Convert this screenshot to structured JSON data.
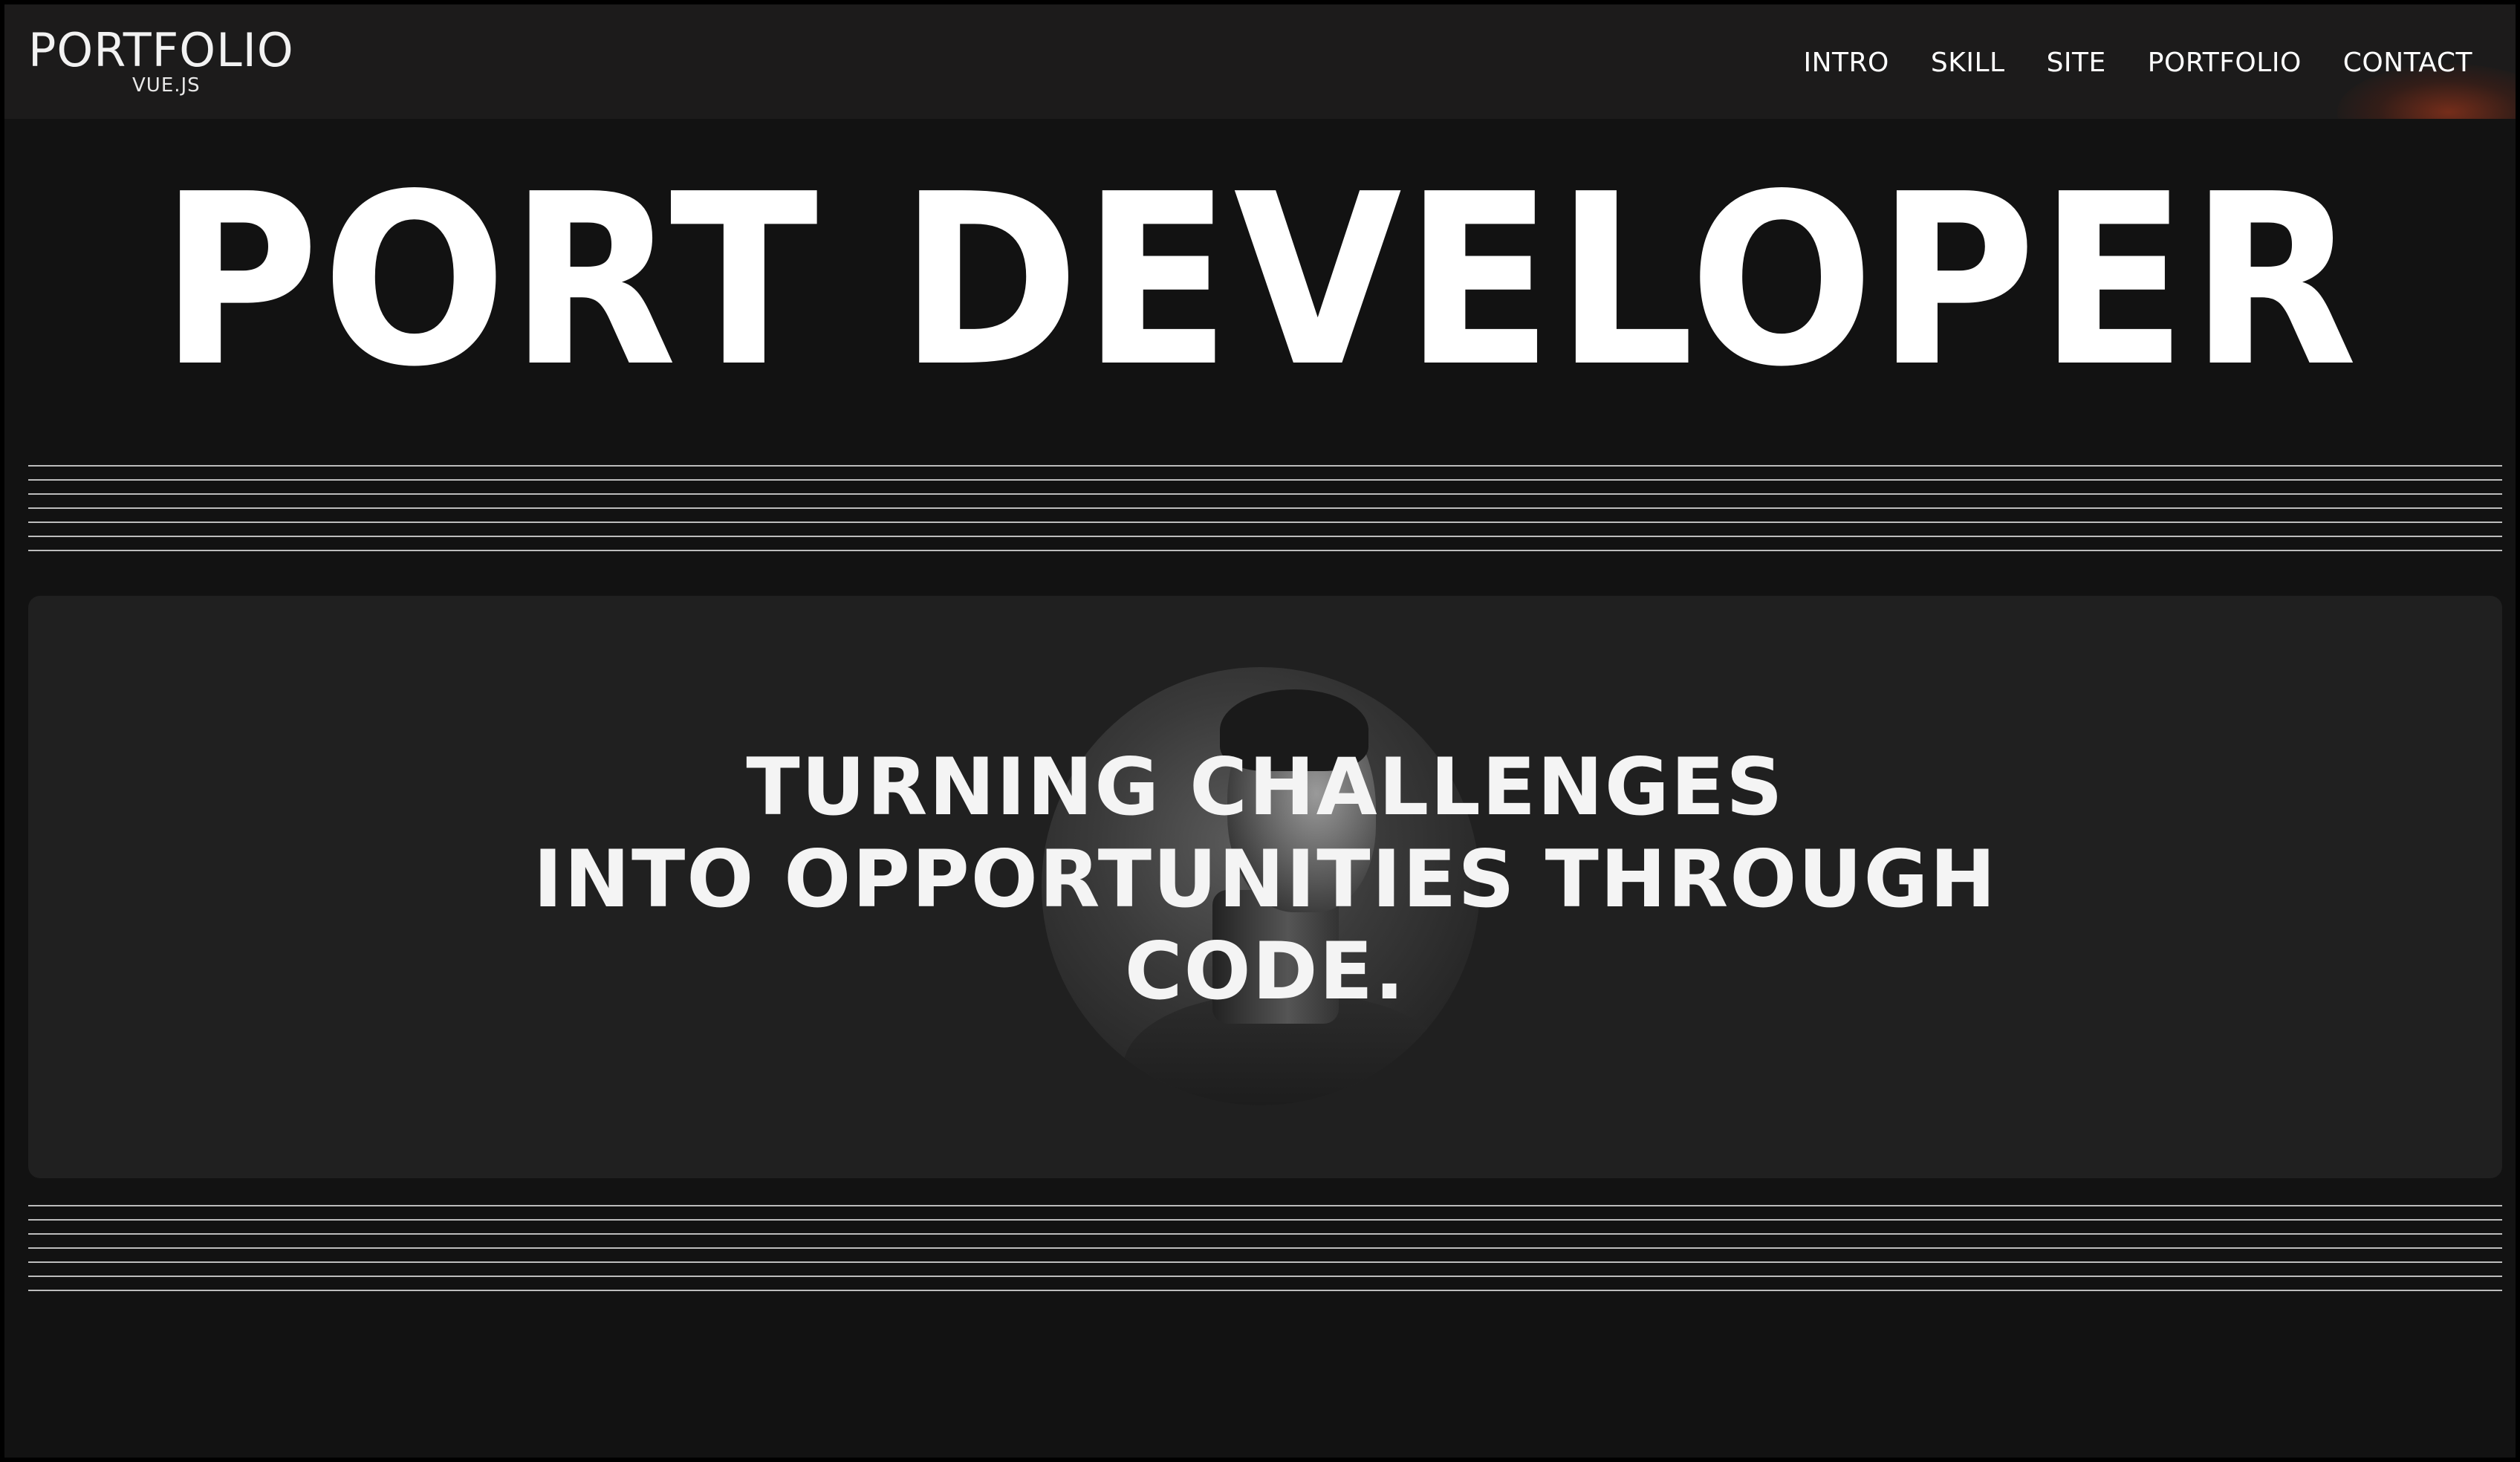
{
  "header": {
    "logo_title": "PORTFOLIO",
    "logo_subtitle": "VUE.JS",
    "nav": [
      {
        "label": "INTRO"
      },
      {
        "label": "SKILL"
      },
      {
        "label": "SITE"
      },
      {
        "label": "PORTFOLIO"
      },
      {
        "label": "CONTACT"
      }
    ]
  },
  "hero": {
    "title": "PORT DEVELOPER"
  },
  "card": {
    "tagline_lines": [
      "TURNING CHALLENGES",
      "INTO OPPORTUNITIES THROUGH",
      "CODE."
    ]
  },
  "colors": {
    "background": "#121212",
    "header_bg": "#1c1b1b",
    "card_bg": "#202020",
    "text": "#ffffff",
    "line": "#bdbdbd"
  }
}
